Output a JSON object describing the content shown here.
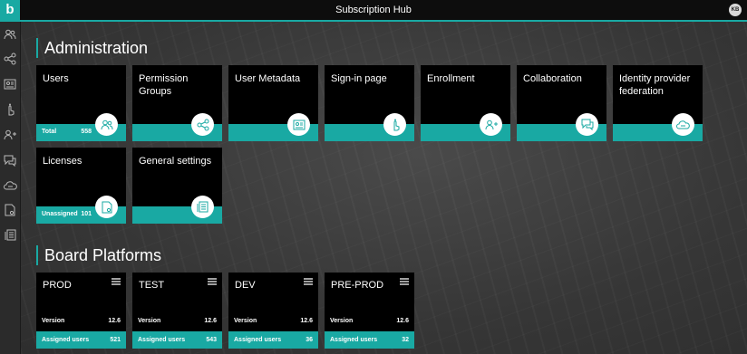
{
  "app": {
    "logo_letter": "b",
    "title": "Subscription Hub",
    "user_initials": "KB"
  },
  "sidebar": {
    "items": [
      {
        "icon": "users-icon"
      },
      {
        "icon": "share-icon"
      },
      {
        "icon": "metadata-icon"
      },
      {
        "icon": "hand-icon"
      },
      {
        "icon": "user-add-icon"
      },
      {
        "icon": "chat-icon"
      },
      {
        "icon": "cloud-icon"
      },
      {
        "icon": "license-icon"
      },
      {
        "icon": "settings-list-icon"
      }
    ]
  },
  "administration": {
    "title": "Administration",
    "tiles": [
      {
        "title": "Users",
        "footer_label": "Total",
        "footer_value": "558",
        "icon": "users-icon"
      },
      {
        "title": "Permission Groups",
        "icon": "share-icon"
      },
      {
        "title": "User Metadata",
        "icon": "metadata-icon"
      },
      {
        "title": "Sign-in page",
        "icon": "hand-icon"
      },
      {
        "title": "Enrollment",
        "icon": "user-add-icon"
      },
      {
        "title": "Collaboration",
        "icon": "chat-icon"
      },
      {
        "title": "Identity provider federation",
        "icon": "cloud-icon"
      },
      {
        "title": "Licenses",
        "footer_label": "Unassigned",
        "footer_value": "101",
        "icon": "license-icon"
      },
      {
        "title": "General settings",
        "icon": "settings-list-icon"
      }
    ]
  },
  "platforms": {
    "title": "Board Platforms",
    "items": [
      {
        "name": "PROD",
        "version_label": "Version",
        "version": "12.6",
        "assigned_label": "Assigned users",
        "assigned": "521"
      },
      {
        "name": "TEST",
        "version_label": "Version",
        "version": "12.6",
        "assigned_label": "Assigned users",
        "assigned": "543"
      },
      {
        "name": "DEV",
        "version_label": "Version",
        "version": "12.6",
        "assigned_label": "Assigned users",
        "assigned": "36"
      },
      {
        "name": "PRE-PROD",
        "version_label": "Version",
        "version": "12.6",
        "assigned_label": "Assigned users",
        "assigned": "32"
      }
    ]
  },
  "colors": {
    "accent": "#19a9a3",
    "tile_bg": "#000000",
    "topbar_bg": "#0d0d0d"
  }
}
